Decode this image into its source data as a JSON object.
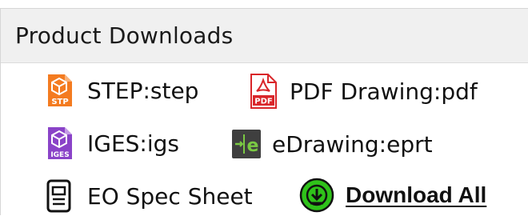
{
  "panel": {
    "title": "Product Downloads"
  },
  "downloads": [
    {
      "label": "STEP:step",
      "icon": "step-file-icon",
      "color": "#f47b20"
    },
    {
      "label": "PDF Drawing:pdf",
      "icon": "pdf-file-icon",
      "color": "#d9262a"
    },
    {
      "label": "IGES:igs",
      "icon": "iges-file-icon",
      "color": "#8a43c8"
    },
    {
      "label": "eDrawing:eprt",
      "icon": "edrawing-icon",
      "color": "#3f3f3f"
    },
    {
      "label": "EO Spec Sheet",
      "icon": "spec-sheet-icon",
      "color": "#111111"
    }
  ],
  "download_all": {
    "label": "Download All",
    "icon": "download-circle-icon",
    "color": "#2fc21a"
  },
  "icon_text": {
    "step": "STP",
    "iges": "IGES",
    "pdf": "PDF",
    "edrawing": "e"
  }
}
